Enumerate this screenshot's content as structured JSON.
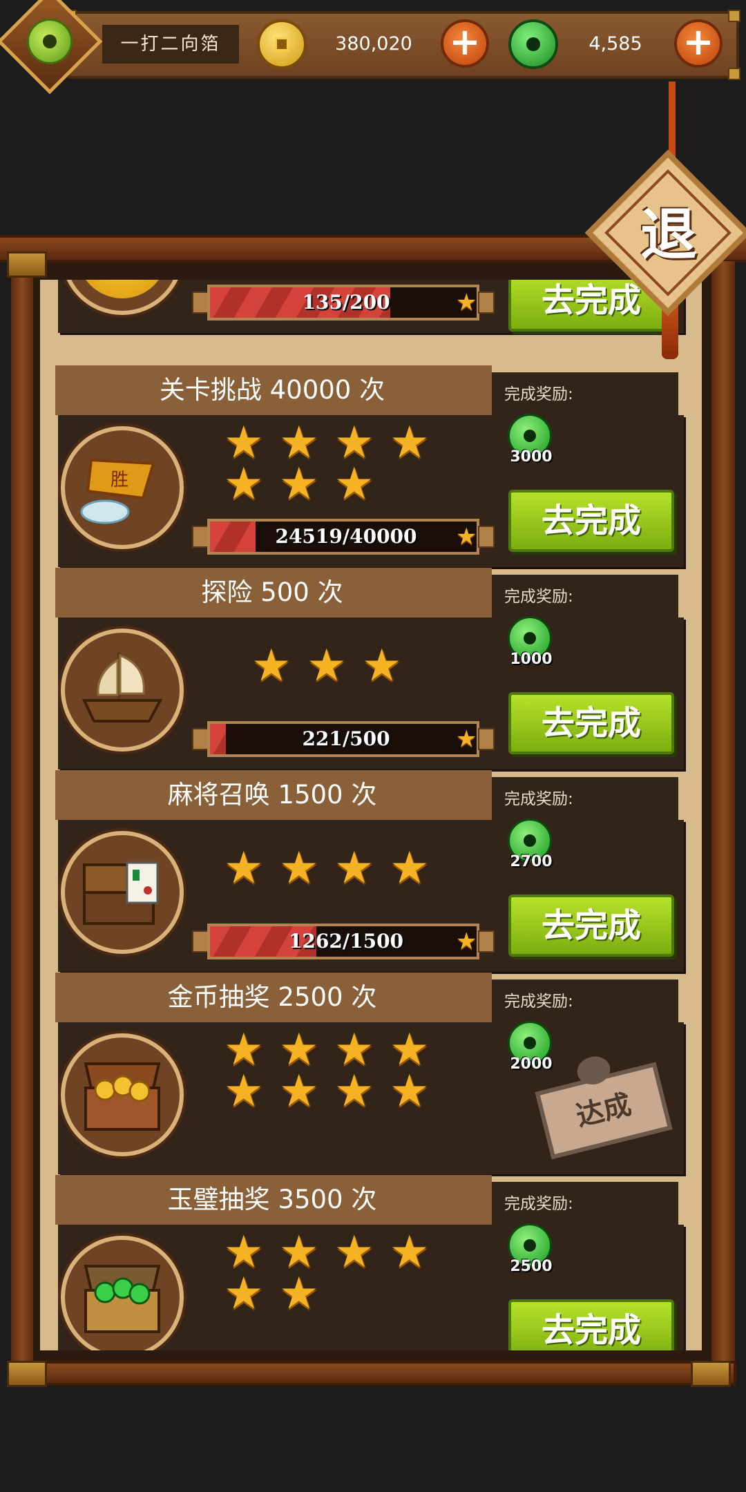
{
  "header": {
    "username": "一打二向箔",
    "gold": "380,020",
    "jade": "4,585",
    "exit_label": "退"
  },
  "icons": {
    "avatar": "jade-disc-avatar",
    "gold": "copper-coin-icon",
    "jade": "jade-disc-icon",
    "add": "plus-icon"
  },
  "colors": {
    "accent_green": "#9ccf1c",
    "progress_red": "#d3433b",
    "frame_brown": "#8a4a1e",
    "paper": "#d7bb8d"
  },
  "reward_label": "完成奖励:",
  "go_label": "去完成",
  "tasks": [
    {
      "title": "",
      "progress_text": "135/200",
      "progress": 0.675,
      "stars": 0,
      "reward": "",
      "status": "go",
      "icon": "gold-ingot-icon"
    },
    {
      "title": "关卡挑战 40000 次",
      "progress_text": "24519/40000",
      "progress": 0.613,
      "stars": 7,
      "reward": "3000",
      "status": "go",
      "icon": "victory-banner-icon"
    },
    {
      "title": "探险 500 次",
      "progress_text": "221/500",
      "progress": 0.442,
      "stars": 3,
      "reward": "1000",
      "status": "go",
      "icon": "treasure-ship-icon"
    },
    {
      "title": "麻将召唤 1500 次",
      "progress_text": "1262/1500",
      "progress": 0.841,
      "stars": 4,
      "reward": "2700",
      "status": "go",
      "icon": "mahjong-chest-icon"
    },
    {
      "title": "金币抽奖 2500 次",
      "progress_text": "",
      "progress": 1,
      "stars": 8,
      "reward": "2000",
      "status": "done",
      "done_label": "达成",
      "icon": "gold-chest-icon"
    },
    {
      "title": "玉璧抽奖 3500 次",
      "progress_text": "",
      "progress": 0,
      "stars": 6,
      "reward": "2500",
      "status": "go",
      "icon": "jade-chest-icon"
    }
  ]
}
